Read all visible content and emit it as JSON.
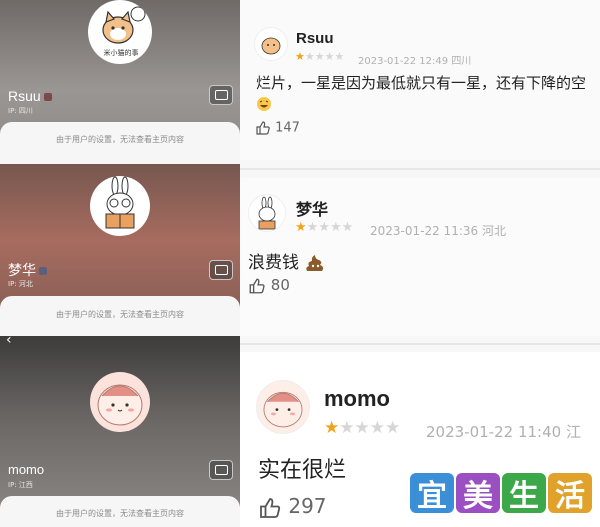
{
  "privacy_notice": "由于用户的设置，无法查看主页内容",
  "profiles": [
    {
      "username": "Rsuu",
      "ip": "IP: 四川",
      "avatar_caption": "米小猫的事"
    },
    {
      "username": "梦华",
      "ip": "IP: 河北"
    },
    {
      "username": "momo",
      "ip": "IP: 江西"
    }
  ],
  "comments": [
    {
      "username": "Rsuu",
      "rating": 1,
      "max_rating": 5,
      "date": "2023-01-22 12:49",
      "region": "四川",
      "text": "烂片，一星是因为最低就只有一星，还有下降的空",
      "likes": "147"
    },
    {
      "username": "梦华",
      "rating": 1,
      "max_rating": 5,
      "date": "2023-01-22 11:36",
      "region": "河北",
      "text": "浪费钱",
      "likes": "80"
    },
    {
      "username": "momo",
      "rating": 1,
      "max_rating": 5,
      "date": "2023-01-22 11:40",
      "region": "江",
      "text": "实在很烂",
      "likes": "297"
    }
  ],
  "watermark": {
    "chars": [
      "宜",
      "美",
      "生",
      "活"
    ],
    "colors": [
      "#3a8fd6",
      "#9a4fc2",
      "#3da84a",
      "#e0a22b"
    ]
  }
}
